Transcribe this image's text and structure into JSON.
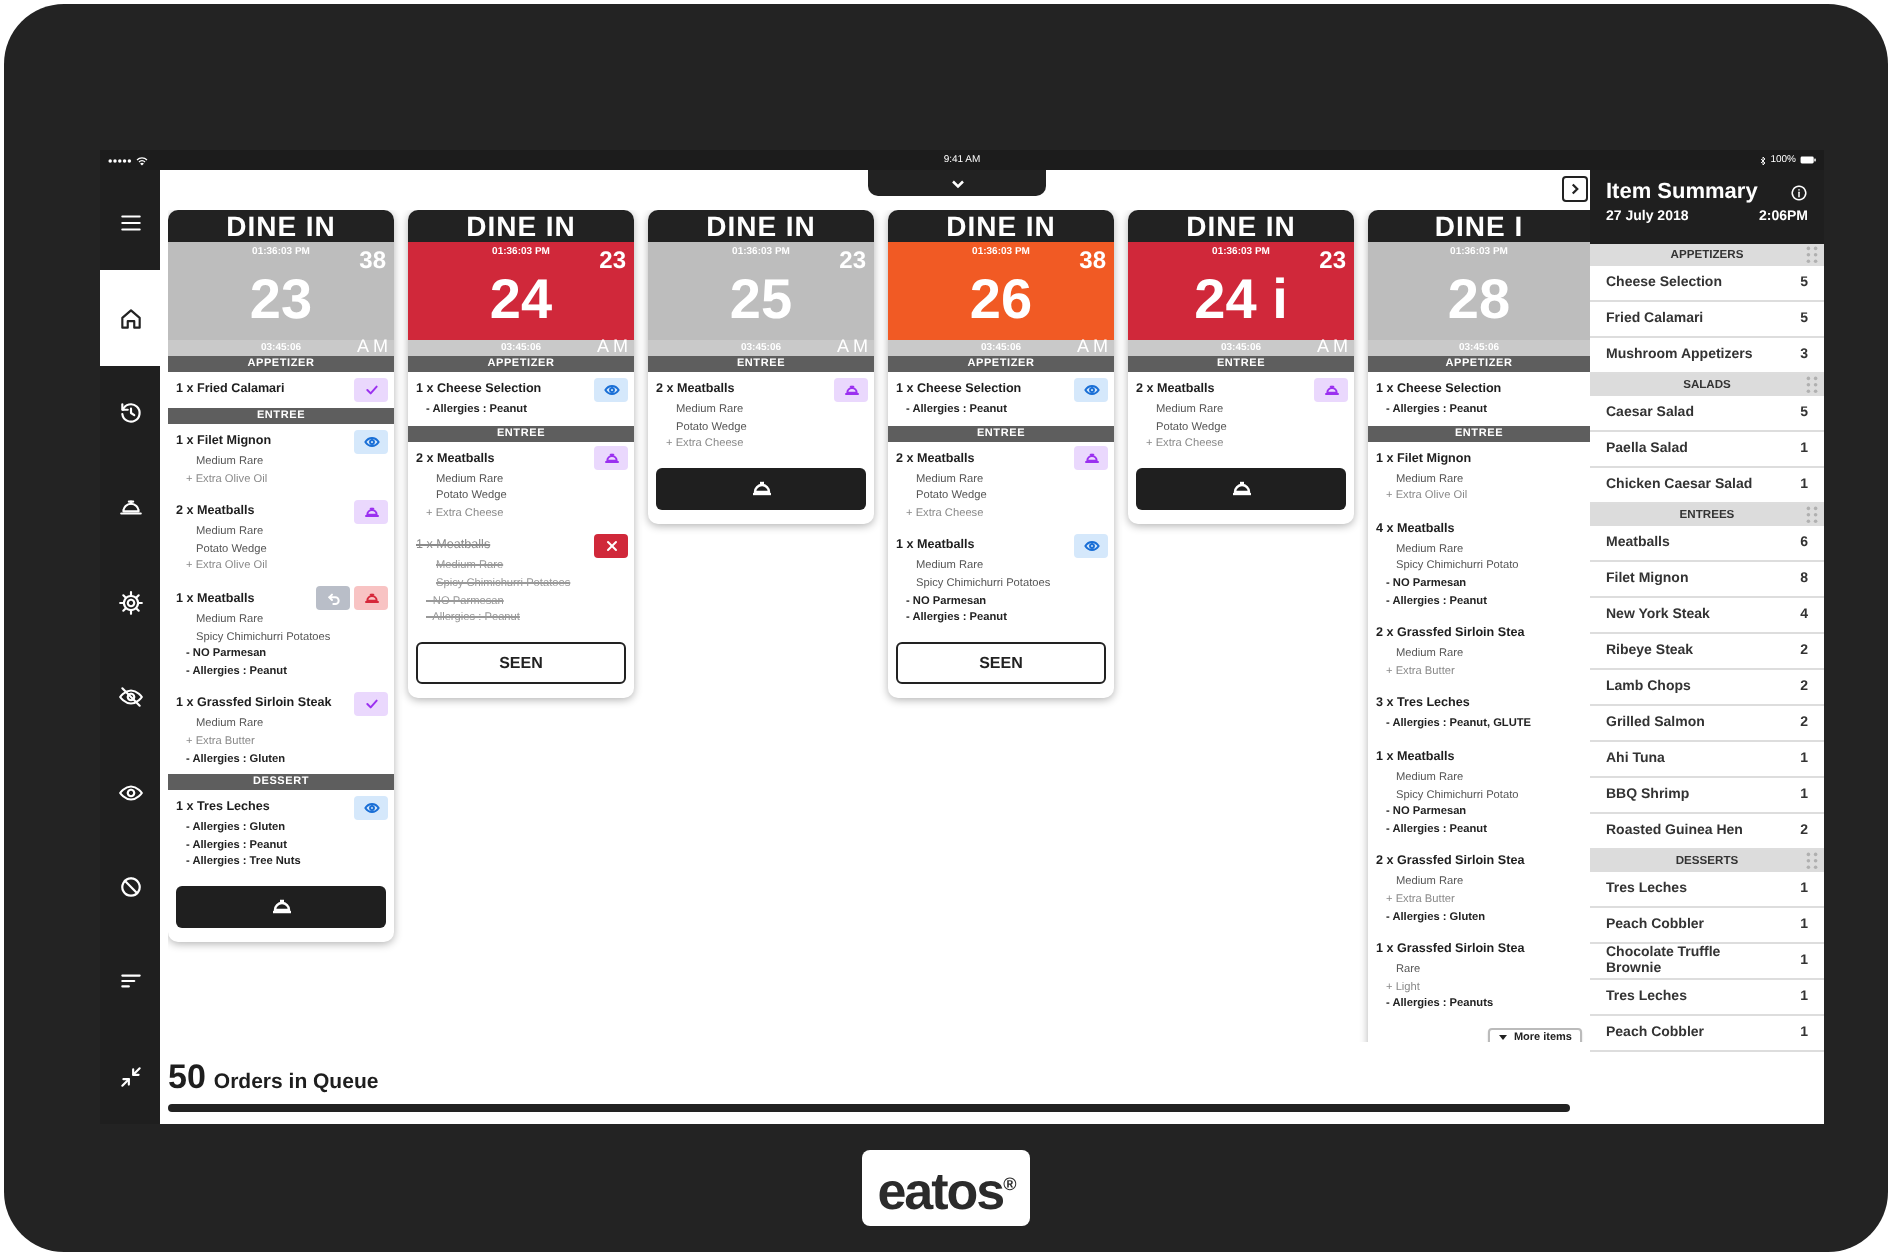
{
  "status_bar": {
    "time": "9:41 AM",
    "battery": "100%"
  },
  "sidebar": {
    "items": [
      {
        "kind": "menu",
        "selected": false
      },
      {
        "kind": "home",
        "selected": true
      },
      {
        "kind": "history",
        "selected": false
      },
      {
        "kind": "bell",
        "selected": false
      },
      {
        "kind": "settings",
        "selected": false
      },
      {
        "kind": "hidden",
        "selected": false
      },
      {
        "kind": "visible",
        "selected": false
      },
      {
        "kind": "blocked",
        "selected": false
      },
      {
        "kind": "filter",
        "selected": false
      },
      {
        "kind": "collapse",
        "selected": false
      }
    ]
  },
  "tickets": [
    {
      "order_type": "DINE IN",
      "placed_time": "01:36:03 PM",
      "elapsed": "38",
      "number": "23",
      "timer": "03:45:06",
      "meridiem": "A M",
      "color": "#bdbdbd",
      "footer": {
        "kind": "serve"
      },
      "sections": [
        {
          "category": "APPETIZER",
          "items": [
            {
              "name": "1 x Fried Calamari",
              "cancelled": false,
              "actions": [
                {
                  "kind": "check"
                }
              ]
            }
          ]
        },
        {
          "category": "ENTREE",
          "items": [
            {
              "name": "1 x Filet Mignon",
              "cancelled": false,
              "actions": [
                {
                  "kind": "eye"
                }
              ],
              "lines": [
                {
                  "kind": "prep",
                  "text": "Medium Rare"
                },
                {
                  "kind": "add",
                  "text": "+ Extra Olive Oil"
                }
              ]
            },
            {
              "name": "2 x Meatballs",
              "cancelled": false,
              "actions": [
                {
                  "kind": "bell"
                }
              ],
              "lines": [
                {
                  "kind": "prep",
                  "text": "Medium Rare"
                },
                {
                  "kind": "prep",
                  "text": "Potato Wedge"
                },
                {
                  "kind": "add",
                  "text": "+ Extra Olive Oil"
                }
              ]
            },
            {
              "name": "1 x Meatballs",
              "cancelled": false,
              "actions": [
                {
                  "kind": "undo"
                },
                {
                  "kind": "alert"
                }
              ],
              "lines": [
                {
                  "kind": "prep",
                  "text": "Medium Rare"
                },
                {
                  "kind": "prep",
                  "text": "Spicy Chimichurri Potatoes"
                },
                {
                  "kind": "note",
                  "text": "- NO Parmesan"
                },
                {
                  "kind": "note",
                  "text": "- Allergies : Peanut"
                }
              ]
            },
            {
              "name": "1 x Grassfed Sirloin Steak",
              "cancelled": false,
              "actions": [
                {
                  "kind": "check"
                }
              ],
              "lines": [
                {
                  "kind": "prep",
                  "text": "Medium Rare"
                },
                {
                  "kind": "add",
                  "text": "+ Extra Butter"
                },
                {
                  "kind": "note",
                  "text": "- Allergies : Gluten"
                }
              ]
            }
          ]
        },
        {
          "category": "DESSERT",
          "items": [
            {
              "name": "1 x Tres Leches",
              "cancelled": false,
              "actions": [
                {
                  "kind": "eye"
                }
              ],
              "lines": [
                {
                  "kind": "note",
                  "text": "- Allergies : Gluten"
                },
                {
                  "kind": "note",
                  "text": "- Allergies : Peanut"
                },
                {
                  "kind": "note",
                  "text": "- Allergies : Tree Nuts"
                }
              ]
            }
          ]
        }
      ]
    },
    {
      "order_type": "DINE IN",
      "placed_time": "01:36:03 PM",
      "elapsed": "23",
      "number": "24",
      "timer": "03:45:06",
      "meridiem": "A M",
      "color": "#d0283a",
      "footer": {
        "kind": "seen",
        "label": "SEEN"
      },
      "sections": [
        {
          "category": "APPETIZER",
          "items": [
            {
              "name": "1 x Cheese Selection",
              "cancelled": false,
              "actions": [
                {
                  "kind": "eye"
                }
              ],
              "lines": [
                {
                  "kind": "note",
                  "text": "- Allergies : Peanut"
                }
              ]
            }
          ]
        },
        {
          "category": "ENTREE",
          "items": [
            {
              "name": "2 x Meatballs",
              "cancelled": false,
              "actions": [
                {
                  "kind": "bell"
                }
              ],
              "lines": [
                {
                  "kind": "prep",
                  "text": "Medium Rare"
                },
                {
                  "kind": "prep",
                  "text": "Potato Wedge"
                },
                {
                  "kind": "add",
                  "text": "+ Extra Cheese"
                }
              ]
            },
            {
              "name": "1 x Meatballs",
              "cancelled": true,
              "actions": [
                {
                  "kind": "cancel"
                }
              ],
              "lines": [
                {
                  "kind": "prep",
                  "text": "Medium Rare"
                },
                {
                  "kind": "prep",
                  "text": "Spicy Chimichurri Potatoes"
                },
                {
                  "kind": "note",
                  "text": "- NO Parmesan"
                },
                {
                  "kind": "note",
                  "text": "- Allergies : Peanut"
                }
              ]
            }
          ]
        }
      ]
    },
    {
      "order_type": "DINE IN",
      "placed_time": "01:36:03 PM",
      "elapsed": "23",
      "number": "25",
      "timer": "03:45:06",
      "meridiem": "A M",
      "color": "#bdbdbd",
      "footer": {
        "kind": "serve"
      },
      "sections": [
        {
          "category": "ENTREE",
          "items": [
            {
              "name": "2 x Meatballs",
              "cancelled": false,
              "actions": [
                {
                  "kind": "bell"
                }
              ],
              "lines": [
                {
                  "kind": "prep",
                  "text": "Medium Rare"
                },
                {
                  "kind": "prep",
                  "text": "Potato Wedge"
                },
                {
                  "kind": "add",
                  "text": "+ Extra Cheese"
                }
              ]
            }
          ]
        }
      ]
    },
    {
      "order_type": "DINE IN",
      "placed_time": "01:36:03 PM",
      "elapsed": "38",
      "number": "26",
      "timer": "03:45:06",
      "meridiem": "A M",
      "color": "#f15a24",
      "footer": {
        "kind": "seen",
        "label": "SEEN"
      },
      "sections": [
        {
          "category": "APPETIZER",
          "items": [
            {
              "name": "1 x Cheese Selection",
              "cancelled": false,
              "actions": [
                {
                  "kind": "eye"
                }
              ],
              "lines": [
                {
                  "kind": "note",
                  "text": "- Allergies : Peanut"
                }
              ]
            }
          ]
        },
        {
          "category": "ENTREE",
          "items": [
            {
              "name": "2 x Meatballs",
              "cancelled": false,
              "actions": [
                {
                  "kind": "bell"
                }
              ],
              "lines": [
                {
                  "kind": "prep",
                  "text": "Medium Rare"
                },
                {
                  "kind": "prep",
                  "text": "Potato Wedge"
                },
                {
                  "kind": "add",
                  "text": "+ Extra Cheese"
                }
              ]
            },
            {
              "name": "1 x Meatballs",
              "cancelled": false,
              "actions": [
                {
                  "kind": "eye"
                }
              ],
              "lines": [
                {
                  "kind": "prep",
                  "text": "Medium Rare"
                },
                {
                  "kind": "prep",
                  "text": "Spicy Chimichurri Potatoes"
                },
                {
                  "kind": "note",
                  "text": "- NO Parmesan"
                },
                {
                  "kind": "note",
                  "text": "- Allergies : Peanut"
                }
              ]
            }
          ]
        }
      ]
    },
    {
      "order_type": "DINE IN",
      "placed_time": "01:36:03 PM",
      "elapsed": "23",
      "number": "24 i",
      "timer": "03:45:06",
      "meridiem": "A M",
      "color": "#d0283a",
      "footer": {
        "kind": "serve"
      },
      "sections": [
        {
          "category": "ENTREE",
          "items": [
            {
              "name": "2 x Meatballs",
              "cancelled": false,
              "actions": [
                {
                  "kind": "bell"
                }
              ],
              "lines": [
                {
                  "kind": "prep",
                  "text": "Medium Rare"
                },
                {
                  "kind": "prep",
                  "text": "Potato Wedge"
                },
                {
                  "kind": "add",
                  "text": "+ Extra Cheese"
                }
              ]
            }
          ]
        }
      ]
    },
    {
      "order_type": "DINE I",
      "placed_time": "01:36:03 PM",
      "number": "28",
      "timer": "03:45:06",
      "color": "#bdbdbd",
      "footer": {
        "kind": "more",
        "label": "More items"
      },
      "sections": [
        {
          "category": "APPETIZER",
          "items": [
            {
              "name": "1 x Cheese Selection",
              "cancelled": false,
              "lines": [
                {
                  "kind": "note",
                  "text": "- Allergies : Peanut"
                }
              ]
            }
          ]
        },
        {
          "category": "ENTREE",
          "items": [
            {
              "name": "1 x Filet Mignon",
              "cancelled": false,
              "lines": [
                {
                  "kind": "prep",
                  "text": "Medium Rare"
                },
                {
                  "kind": "add",
                  "text": "+ Extra Olive Oil"
                }
              ]
            },
            {
              "name": "4 x Meatballs",
              "cancelled": false,
              "lines": [
                {
                  "kind": "prep",
                  "text": "Medium Rare"
                },
                {
                  "kind": "prep",
                  "text": "Spicy Chimichurri Potato"
                },
                {
                  "kind": "note",
                  "text": "- NO Parmesan"
                },
                {
                  "kind": "note",
                  "text": "- Allergies : Peanut"
                }
              ]
            },
            {
              "name": "2 x Grassfed Sirloin Stea",
              "cancelled": false,
              "lines": [
                {
                  "kind": "prep",
                  "text": "Medium Rare"
                },
                {
                  "kind": "add",
                  "text": "+ Extra Butter"
                }
              ]
            },
            {
              "name": "3 x Tres Leches",
              "cancelled": false,
              "lines": [
                {
                  "kind": "note",
                  "text": "- Allergies : Peanut, GLUTE"
                }
              ]
            },
            {
              "name": "1 x Meatballs",
              "cancelled": false,
              "lines": [
                {
                  "kind": "prep",
                  "text": "Medium Rare"
                },
                {
                  "kind": "prep",
                  "text": "Spicy Chimichurri Potato"
                },
                {
                  "kind": "note",
                  "text": "- NO Parmesan"
                },
                {
                  "kind": "note",
                  "text": "- Allergies : Peanut"
                }
              ]
            },
            {
              "name": "2 x Grassfed Sirloin Stea",
              "cancelled": false,
              "lines": [
                {
                  "kind": "prep",
                  "text": "Medium Rare"
                },
                {
                  "kind": "add",
                  "text": "+ Extra Butter"
                },
                {
                  "kind": "note",
                  "text": "- Allergies : Gluten"
                }
              ]
            },
            {
              "name": "1 x Grassfed Sirloin Stea",
              "cancelled": false,
              "lines": [
                {
                  "kind": "prep",
                  "text": "Rare"
                },
                {
                  "kind": "add",
                  "text": "+ Light"
                },
                {
                  "kind": "note",
                  "text": "- Allergies : Peanuts"
                }
              ]
            }
          ]
        }
      ]
    }
  ],
  "queue": {
    "count": "50",
    "label": "Orders in Queue"
  },
  "summary": {
    "title": "Item Summary",
    "date": "27 July 2018",
    "time": "2:06PM",
    "groups": [
      {
        "category": "APPETIZERS",
        "items": [
          {
            "name": "Cheese Selection",
            "count": "5"
          },
          {
            "name": "Fried Calamari",
            "count": "5"
          },
          {
            "name": "Mushroom Appetizers",
            "count": "3"
          }
        ]
      },
      {
        "category": "SALADS",
        "items": [
          {
            "name": "Caesar Salad",
            "count": "5"
          },
          {
            "name": "Paella Salad",
            "count": "1"
          },
          {
            "name": "Chicken Caesar Salad",
            "count": "1"
          }
        ]
      },
      {
        "category": "ENTREES",
        "items": [
          {
            "name": "Meatballs",
            "count": "6"
          },
          {
            "name": "Filet Mignon",
            "count": "8"
          },
          {
            "name": "New York Steak",
            "count": "4"
          },
          {
            "name": "Ribeye Steak",
            "count": "2"
          },
          {
            "name": "Lamb Chops",
            "count": "2"
          },
          {
            "name": "Grilled Salmon",
            "count": "2"
          },
          {
            "name": "Ahi Tuna",
            "count": "1"
          },
          {
            "name": "BBQ Shrimp",
            "count": "1"
          },
          {
            "name": "Roasted Guinea Hen",
            "count": "2"
          }
        ]
      },
      {
        "category": "DESSERTS",
        "items": [
          {
            "name": "Tres Leches",
            "count": "1"
          },
          {
            "name": "Peach Cobbler",
            "count": "1"
          },
          {
            "name": "Chocolate Truffle Brownie",
            "count": "1"
          },
          {
            "name": "Tres Leches",
            "count": "1"
          },
          {
            "name": "Peach Cobbler",
            "count": "1"
          }
        ]
      }
    ]
  },
  "device": {
    "logo": "eatos$^{®}$"
  }
}
